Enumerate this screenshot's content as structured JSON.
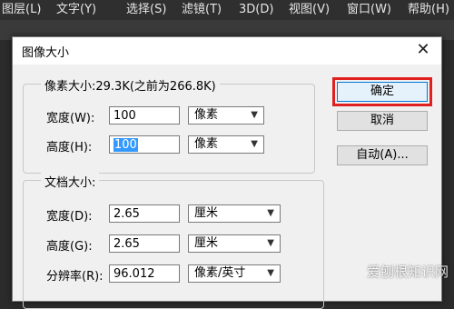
{
  "menubar": {
    "items": [
      "图层(L)",
      "文字(Y)",
      "选择(S)",
      "滤镜(T)",
      "3D(D)",
      "视图(V)",
      "窗口(W)",
      "帮助(H)"
    ]
  },
  "dialog": {
    "title": "图像大小",
    "pixel_dimensions": {
      "legend": "像素大小:29.3K(之前为266.8K)",
      "width_label": "宽度(W):",
      "width_value": "100",
      "width_unit": "像素",
      "height_label": "高度(H):",
      "height_value": "100",
      "height_unit": "像素"
    },
    "document_size": {
      "legend": "文档大小:",
      "width_label": "宽度(D):",
      "width_value": "2.65",
      "width_unit": "厘米",
      "height_label": "高度(G):",
      "height_value": "2.65",
      "height_unit": "厘米",
      "resolution_label": "分辨率(R):",
      "resolution_value": "96.012",
      "resolution_unit": "像素/英寸"
    },
    "buttons": {
      "ok": "确定",
      "cancel": "取消",
      "auto": "自动(A)..."
    }
  },
  "watermark": "爱刨根知识网",
  "colors": {
    "highlight": "#e0201e",
    "selection": "#3399ff",
    "default_button_border": "#0078d7"
  }
}
